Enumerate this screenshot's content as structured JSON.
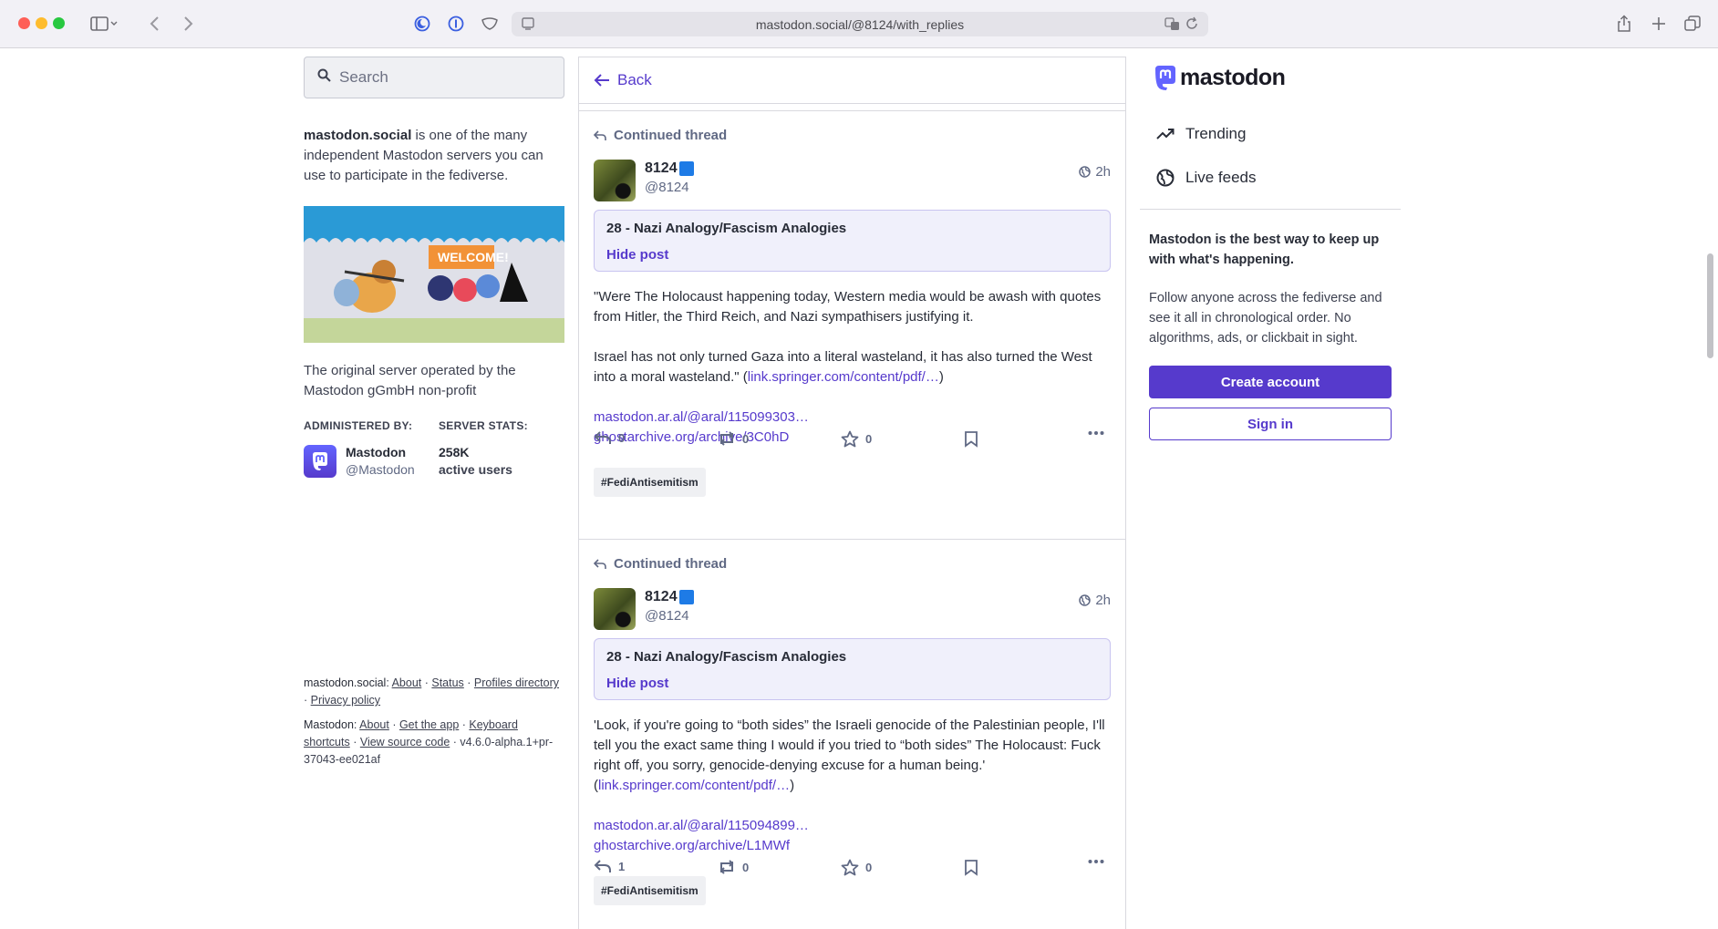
{
  "browser": {
    "url": "mastodon.social/@8124/with_replies"
  },
  "search": {
    "placeholder": "Search"
  },
  "server": {
    "name": "mastodon.social",
    "about_rest": " is one of the many independent Mastodon servers you can use to participate in the fediverse.",
    "description": "The original server operated by the Mastodon gGmbH non-profit",
    "admin_label": "ADMINISTERED BY:",
    "admin_name": "Mastodon",
    "admin_handle": "@Mastodon",
    "stats_label": "SERVER STATS:",
    "stats_count": "258K",
    "stats_sub": "active users",
    "banner_text": "WELCOME!"
  },
  "footer": {
    "server_prefix": "mastodon.social",
    "about": "About",
    "status": "Status",
    "profiles": "Profiles directory",
    "privacy": "Privacy policy",
    "mastodon_prefix": "Mastodon",
    "about2": "About",
    "get_app": "Get the app",
    "keyboard": "Keyboard shortcuts",
    "source": "View source code",
    "version": "v4.6.0-alpha.1+pr-37043-ee021af"
  },
  "nav": {
    "back": "Back"
  },
  "posts": [
    {
      "context": "Continued thread",
      "author": "8124",
      "handle": "@8124",
      "time": "2h",
      "cw_title": "28 - Nazi Analogy/Fascism Analogies",
      "cw_action": "Hide post",
      "p1": "\"Were The Holocaust happening today, Western media would be awash with quotes from Hitler, the Third Reich, and Nazi sympathisers justifying it.",
      "p2_text": "Israel has not only turned Gaza into a literal wasteland, it has also turned the West into a moral wasteland.\" (",
      "p2_link": "link.springer.com/content/pdf/…",
      "p2_end": ")",
      "link1": "mastodon.ar.al/@aral/115099303…",
      "link2": "ghostarchive.org/archive/3C0hD",
      "tag": "#FediAntisemitism",
      "replies": "0",
      "boosts": "0",
      "favs": "0"
    },
    {
      "context": "Continued thread",
      "author": "8124",
      "handle": "@8124",
      "time": "2h",
      "cw_title": "28 - Nazi Analogy/Fascism Analogies",
      "cw_action": "Hide post",
      "p1_text": "'Look, if you're going to “both sides” the Israeli genocide of the Palestinian people, I'll tell you the exact same thing I would if you tried to “both sides” The Holocaust: Fuck right off, you sorry, genocide-denying excuse for a human being.' (",
      "p1_link": "link.springer.com/content/pdf/…",
      "p1_end": ")",
      "link1": "mastodon.ar.al/@aral/115094899…",
      "link2": "ghostarchive.org/archive/L1MWf",
      "tag": "#FediAntisemitism",
      "replies": "1",
      "boosts": "0",
      "favs": "0"
    }
  ],
  "sidebar": {
    "logo": "mastodon",
    "trending": "Trending",
    "live": "Live feeds",
    "pitch": "Mastodon is the best way to keep up with what's happening.",
    "pitch2": "Follow anyone across the fediverse and see it all in chronological order. No algorithms, ads, or clickbait in sight.",
    "create": "Create account",
    "signin": "Sign in"
  },
  "colors": {
    "accent": "#563acc",
    "muted": "#606984"
  }
}
